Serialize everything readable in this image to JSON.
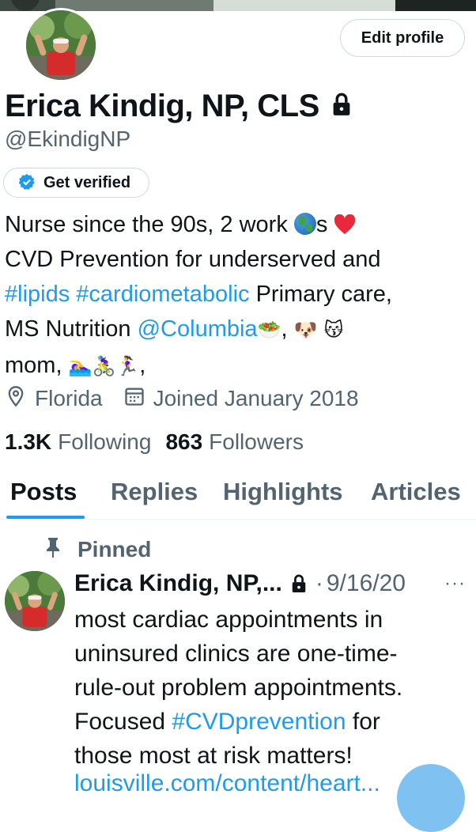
{
  "profile": {
    "name": "Erica Kindig, NP, CLS",
    "handle": "@EkindigNP",
    "edit_label": "Edit profile",
    "verify_label": "Get verified",
    "bio": {
      "line1_a": "Nurse since the 90s, 2 work ",
      "line1_b": "s ",
      "line2": "CVD Prevention for underserved and",
      "tag_lipids": "#lipids",
      "tag_cardio": "#cardiometabolic",
      "line3_rest": " Primary care,",
      "line4_a": "MS Nutrition ",
      "mention": "@Columbia",
      "emoji_salad": "🥗",
      "comma1": ", ",
      "emoji_dog": "🐶",
      "emoji_cat": "😽",
      "line5_a": "mom, ",
      "emoji_swim": "🏊‍♀️",
      "emoji_bike": "🚴‍♀️",
      "emoji_run": "🏃‍♀️",
      "line5_end": ","
    },
    "location": "Florida",
    "joined": "Joined January 2018",
    "following_count": "1.3K",
    "following_label": "Following",
    "followers_count": "863",
    "followers_label": "Followers"
  },
  "tabs": [
    "Posts",
    "Replies",
    "Highlights",
    "Articles"
  ],
  "active_tab": "Posts",
  "pinned_post": {
    "pinned_label": "Pinned",
    "author": "Erica Kindig, NP,...",
    "separator": "·",
    "date": "9/16/20",
    "more": "···",
    "text_lines": [
      "most cardiac appointments in",
      "uninsured clinics are one-time-",
      "rule-out problem appointments."
    ],
    "line4_a": "Focused ",
    "hashtag": "#CVDprevention",
    "line4_b": " for",
    "line5": "those most at risk matters!",
    "link": "louisville.com/content/heart..."
  },
  "colors": {
    "accent": "#1d9bf0",
    "muted": "#536471",
    "text": "#0f1419",
    "border": "#cfd9de"
  },
  "icons": [
    "lock-icon",
    "verified-badge-icon",
    "location-icon",
    "calendar-icon",
    "pin-icon",
    "more-icon",
    "globe-emoji-icon",
    "heart-emoji-icon"
  ]
}
